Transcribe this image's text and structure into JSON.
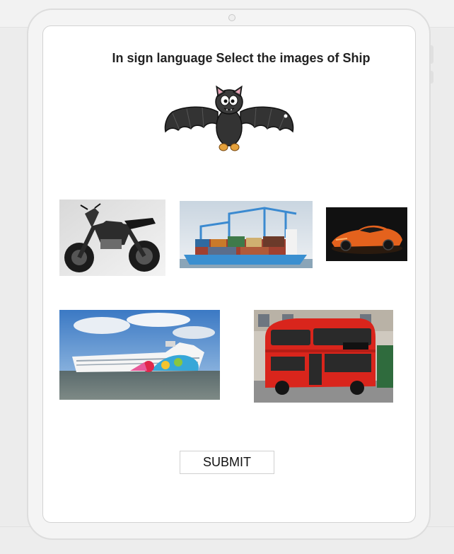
{
  "quiz": {
    "instruction": "In sign language Select the images of Ship",
    "sign_image": "bat-icon",
    "options": [
      {
        "name": "motorcycle",
        "icon": "motorcycle-image"
      },
      {
        "name": "container ship",
        "icon": "container-ship-image"
      },
      {
        "name": "sports car",
        "icon": "sports-car-image"
      },
      {
        "name": "cruise ship",
        "icon": "cruise-ship-image"
      },
      {
        "name": "double decker bus",
        "icon": "double-decker-bus-image"
      }
    ],
    "submit_label": "SUBMIT"
  },
  "colors": {
    "background": "#ececec",
    "device_frame": "#f4f4f4",
    "screen": "#ffffff",
    "text": "#222222"
  }
}
